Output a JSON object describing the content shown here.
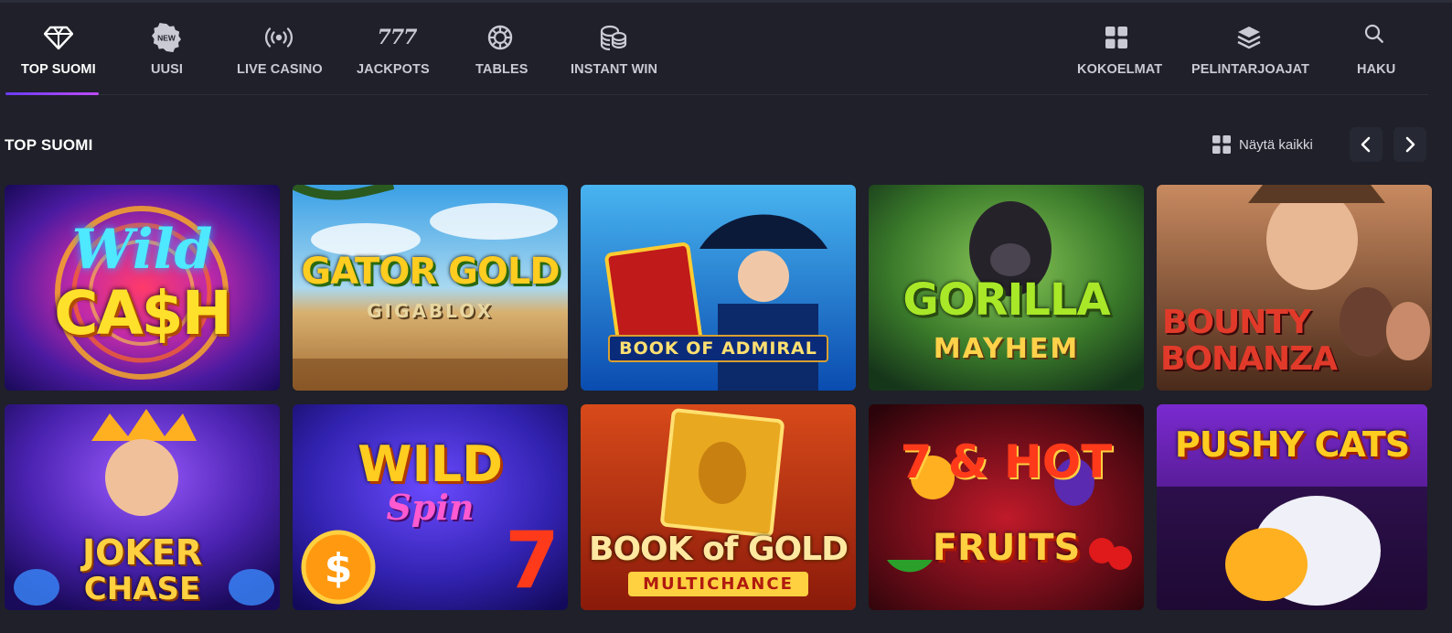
{
  "nav": {
    "items": [
      {
        "label": "TOP SUOMI",
        "icon": "diamond-icon",
        "active": true
      },
      {
        "label": "UUSI",
        "icon": "new-badge-icon",
        "badge": "NEW"
      },
      {
        "label": "LIVE CASINO",
        "icon": "broadcast-icon"
      },
      {
        "label": "JACKPOTS",
        "icon": "777-icon",
        "glyph": "777"
      },
      {
        "label": "TABLES",
        "icon": "poker-chip-icon"
      },
      {
        "label": "INSTANT WIN",
        "icon": "coins-stack-icon"
      },
      {
        "label": "KOKOELMAT",
        "icon": "grid-icon"
      },
      {
        "label": "PELINTARJOAJAT",
        "icon": "layers-icon"
      },
      {
        "label": "HAKU",
        "icon": "search-icon"
      }
    ]
  },
  "section": {
    "title": "TOP SUOMI",
    "view_all": "Näytä kaikki",
    "view_all_icon": "grid-icon",
    "prev_icon": "chevron-left-icon",
    "next_icon": "chevron-right-icon"
  },
  "games": [
    {
      "title": "Wild",
      "title2": "CA$H",
      "bg": "#3a1a7a"
    },
    {
      "title": "GATOR GOLD",
      "title2": "GIGABLOX",
      "bg": "#4aa0d8"
    },
    {
      "title": "BOOK OF ADMIRAL",
      "title2": "",
      "bg": "#1f78d8"
    },
    {
      "title": "GORILLA",
      "title2": "MAYHEM",
      "bg": "#2d5a2a"
    },
    {
      "title": "BOUNTY",
      "title2": "BONANZA",
      "bg": "#7a4a32"
    },
    {
      "title": "JOKER",
      "title2": "CHASE",
      "bg": "#4a2aa0"
    },
    {
      "title": "WILD",
      "title2": "Spin",
      "bg": "#3a2a9a"
    },
    {
      "title": "BOOK of GOLD",
      "title2": "MULTICHANCE",
      "bg": "#c2401a"
    },
    {
      "title": "7 & HOT",
      "title2": "FRUITS",
      "bg": "#7a0a12"
    },
    {
      "title": "PUSHY CATS",
      "title2": "",
      "bg": "#4a1a8a"
    }
  ],
  "colors": {
    "background": "#1f2029",
    "accent": "#7c3cff"
  }
}
